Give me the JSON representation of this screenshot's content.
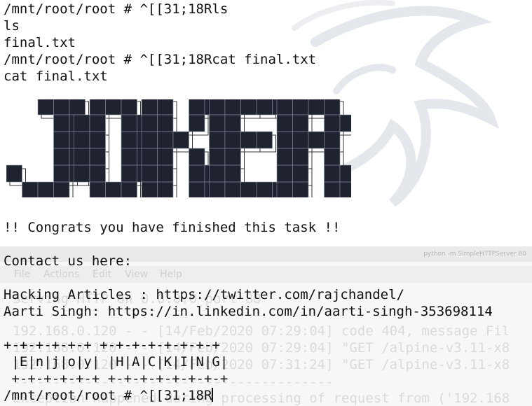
{
  "terminal": {
    "lines": [
      "/mnt/root/root # ^[[31;18Rls",
      "ls",
      "final.txt",
      "/mnt/root/root # ^[[31;18Rcat final.txt",
      "cat final.txt"
    ],
    "banner_word": "JOKER",
    "congrats": "!! Congrats you have finished this task !!",
    "contact_heading": "Contact us here:",
    "contacts": [
      "Hacking Articles : https://twitter.com/rajchandel/",
      "Aarti Singh: https://in.linkedin.com/in/aarti-singh-353698114"
    ],
    "box_top": "+-+-+-+-+-+ +-+-+-+-+-+-+-+",
    "box_text": " |E|n|j|o|y| |H|A|C|K|I|N|G|",
    "box_bottom": " +-+-+-+-+-+ +-+-+-+-+-+-+-+",
    "prompt": "/mnt/root/root # ^[[31;18R"
  },
  "background_window": {
    "title": "python -m SimpleHTTPServer 80",
    "menu": [
      "File",
      "Actions",
      "Edit",
      "View",
      "Help"
    ],
    "lines": [
      "Serving HTTP on 0.0.0.0 port 80",
      "192.168.0.120 - - [14/Feb/2020 07:29:04] code 404, message Fil",
      "192.168.0.120 - - [14/Feb/2020 07:29:04] \"GET /alpine-v3.11-x8",
      "192.168.0.120 - - [14/Feb/2020 07:31:24] \"GET /alpine-v3.11-x8",
      "----------------------------------------",
      "Exception happened during processing of request from ('192.168"
    ]
  },
  "colors": {
    "terminal_text": "#111111",
    "banner_fill": "#1f2330",
    "banner_outline": "#333333"
  }
}
